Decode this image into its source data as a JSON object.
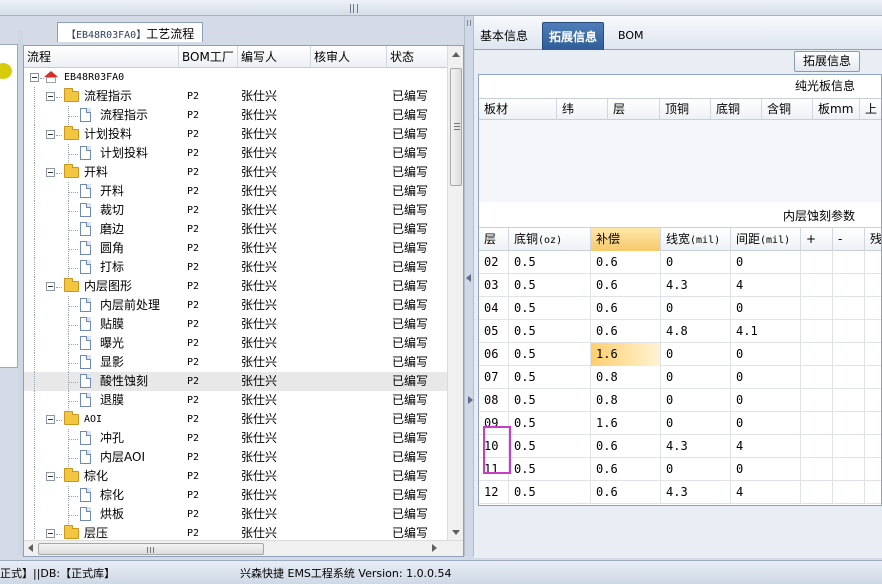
{
  "left_panel": {
    "title_code": "【EB48R03FA0】",
    "title_text": "工艺流程",
    "columns": {
      "flow": "流程",
      "bom": "BOM工厂",
      "writer": "编写人",
      "reviewer": "核审人",
      "status": "状态"
    },
    "rows": [
      {
        "label": "EB48R03FA0",
        "kind": "root",
        "bom": "",
        "writer": "",
        "reviewer": "",
        "status": ""
      },
      {
        "label": "流程指示",
        "kind": "folder",
        "bom": "P2",
        "writer": "张仕兴",
        "reviewer": "",
        "status": "已编写"
      },
      {
        "label": "流程指示",
        "kind": "doc",
        "bom": "P2",
        "writer": "张仕兴",
        "reviewer": "",
        "status": "已编写"
      },
      {
        "label": "计划投料",
        "kind": "folder",
        "bom": "P2",
        "writer": "张仕兴",
        "reviewer": "",
        "status": "已编写"
      },
      {
        "label": "计划投料",
        "kind": "doc",
        "bom": "P2",
        "writer": "张仕兴",
        "reviewer": "",
        "status": "已编写"
      },
      {
        "label": "开料",
        "kind": "folder",
        "bom": "P2",
        "writer": "张仕兴",
        "reviewer": "",
        "status": "已编写"
      },
      {
        "label": "开料",
        "kind": "doc",
        "bom": "P2",
        "writer": "张仕兴",
        "reviewer": "",
        "status": "已编写"
      },
      {
        "label": "裁切",
        "kind": "doc",
        "bom": "P2",
        "writer": "张仕兴",
        "reviewer": "",
        "status": "已编写"
      },
      {
        "label": "磨边",
        "kind": "doc",
        "bom": "P2",
        "writer": "张仕兴",
        "reviewer": "",
        "status": "已编写"
      },
      {
        "label": "圆角",
        "kind": "doc",
        "bom": "P2",
        "writer": "张仕兴",
        "reviewer": "",
        "status": "已编写"
      },
      {
        "label": "打标",
        "kind": "doc",
        "bom": "P2",
        "writer": "张仕兴",
        "reviewer": "",
        "status": "已编写"
      },
      {
        "label": "内层图形",
        "kind": "folder",
        "bom": "P2",
        "writer": "张仕兴",
        "reviewer": "",
        "status": "已编写"
      },
      {
        "label": "内层前处理",
        "kind": "doc",
        "bom": "P2",
        "writer": "张仕兴",
        "reviewer": "",
        "status": "已编写"
      },
      {
        "label": "贴膜",
        "kind": "doc",
        "bom": "P2",
        "writer": "张仕兴",
        "reviewer": "",
        "status": "已编写"
      },
      {
        "label": "曝光",
        "kind": "doc",
        "bom": "P2",
        "writer": "张仕兴",
        "reviewer": "",
        "status": "已编写"
      },
      {
        "label": "显影",
        "kind": "doc",
        "bom": "P2",
        "writer": "张仕兴",
        "reviewer": "",
        "status": "已编写"
      },
      {
        "label": "酸性蚀刻",
        "kind": "doc",
        "bom": "P2",
        "writer": "张仕兴",
        "reviewer": "",
        "status": "已编写",
        "selected": true
      },
      {
        "label": "退膜",
        "kind": "doc",
        "bom": "P2",
        "writer": "张仕兴",
        "reviewer": "",
        "status": "已编写"
      },
      {
        "label": "AOI",
        "kind": "folder",
        "bom": "P2",
        "writer": "张仕兴",
        "reviewer": "",
        "status": "已编写"
      },
      {
        "label": "冲孔",
        "kind": "doc",
        "bom": "P2",
        "writer": "张仕兴",
        "reviewer": "",
        "status": "已编写"
      },
      {
        "label": "内层AOI",
        "kind": "doc",
        "bom": "P2",
        "writer": "张仕兴",
        "reviewer": "",
        "status": "已编写"
      },
      {
        "label": "棕化",
        "kind": "folder",
        "bom": "P2",
        "writer": "张仕兴",
        "reviewer": "",
        "status": "已编写"
      },
      {
        "label": "棕化",
        "kind": "doc",
        "bom": "P2",
        "writer": "张仕兴",
        "reviewer": "",
        "status": "已编写"
      },
      {
        "label": "烘板",
        "kind": "doc",
        "bom": "P2",
        "writer": "张仕兴",
        "reviewer": "",
        "status": "已编写"
      },
      {
        "label": "层压",
        "kind": "folder",
        "bom": "P2",
        "writer": "张仕兴",
        "reviewer": "",
        "status": "已编写"
      }
    ]
  },
  "right_panel": {
    "tabs": [
      {
        "label": "基本信息",
        "active": false
      },
      {
        "label": "拓展信息",
        "active": true
      },
      {
        "label": "BOM",
        "active": false
      }
    ],
    "extend_button": "拓展信息",
    "bare_board": {
      "title": "纯光板信息",
      "columns": [
        "板材",
        "纬",
        "层",
        "顶铜",
        "底铜",
        "含铜",
        "板mm",
        "上"
      ]
    },
    "inner_etch": {
      "title": "内层蚀刻参数",
      "columns": [
        {
          "label": "层",
          "unit": ""
        },
        {
          "label": "底铜",
          "unit": "(oz)"
        },
        {
          "label": "补偿",
          "unit": "",
          "highlight": true
        },
        {
          "label": "线宽",
          "unit": "(mil)"
        },
        {
          "label": "间距",
          "unit": "(mil)"
        },
        {
          "label": "+",
          "unit": ""
        },
        {
          "label": "-",
          "unit": ""
        },
        {
          "label": "残铜",
          "unit": ""
        }
      ],
      "rows": [
        {
          "layer": "02",
          "base_cu": "0.5",
          "comp": "0.6",
          "width": "0",
          "spacing": "0"
        },
        {
          "layer": "03",
          "base_cu": "0.5",
          "comp": "0.6",
          "width": "4.3",
          "spacing": "4"
        },
        {
          "layer": "04",
          "base_cu": "0.5",
          "comp": "0.6",
          "width": "0",
          "spacing": "0"
        },
        {
          "layer": "05",
          "base_cu": "0.5",
          "comp": "0.6",
          "width": "4.8",
          "spacing": "4.1"
        },
        {
          "layer": "06",
          "base_cu": "0.5",
          "comp": "1.6",
          "width": "0",
          "spacing": "0",
          "highlight_comp": true
        },
        {
          "layer": "07",
          "base_cu": "0.5",
          "comp": "0.8",
          "width": "0",
          "spacing": "0"
        },
        {
          "layer": "08",
          "base_cu": "0.5",
          "comp": "0.8",
          "width": "0",
          "spacing": "0"
        },
        {
          "layer": "09",
          "base_cu": "0.5",
          "comp": "1.6",
          "width": "0",
          "spacing": "0"
        },
        {
          "layer": "10",
          "base_cu": "0.5",
          "comp": "0.6",
          "width": "4.3",
          "spacing": "4"
        },
        {
          "layer": "11",
          "base_cu": "0.5",
          "comp": "0.6",
          "width": "0",
          "spacing": "0"
        },
        {
          "layer": "12",
          "base_cu": "0.5",
          "comp": "0.6",
          "width": "4.3",
          "spacing": "4"
        }
      ]
    }
  },
  "status_bar": {
    "left": "正式】||DB:【正式库】",
    "center": "兴森快捷 EMS工程系统 Version: 1.0.0.54"
  },
  "colors": {
    "active_tab": "#3c6aa6",
    "folder": "#f2c640",
    "home_roof": "#d2312b",
    "highlight_cell": "#f7c96b",
    "focus_outline": "#c83cc8",
    "sliver_dot": "#d7cc0a"
  },
  "icons": [
    "home-icon",
    "folder-icon",
    "document-icon",
    "expand-collapse-icon",
    "scroll-arrow-icon"
  ]
}
